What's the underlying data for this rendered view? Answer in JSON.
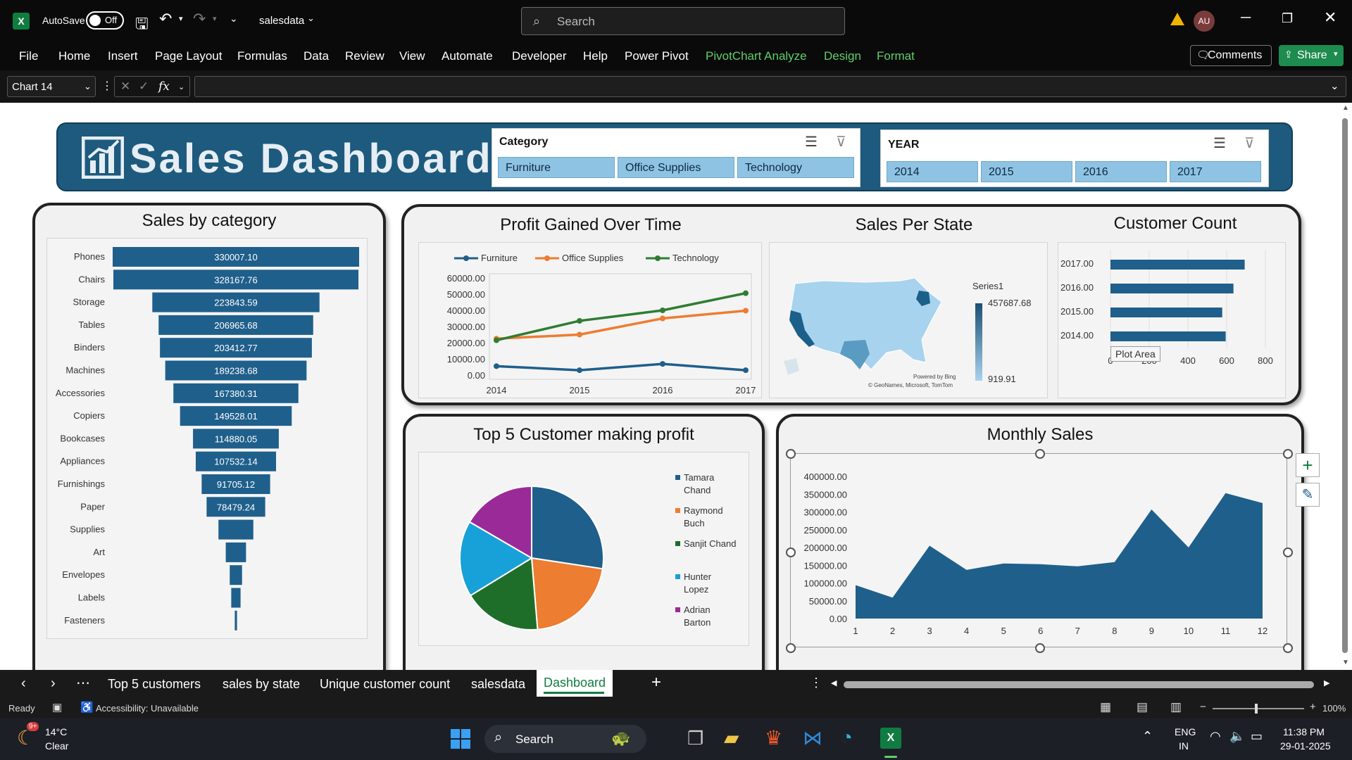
{
  "app": {
    "autosave_label": "AutoSave",
    "autosave_state": "Off",
    "filename": "salesdata",
    "search_placeholder": "Search",
    "user_initials": "AU"
  },
  "ribbon": {
    "tabs": [
      "File",
      "Home",
      "Insert",
      "Page Layout",
      "Formulas",
      "Data",
      "Review",
      "View",
      "Automate",
      "Developer",
      "Help",
      "Power Pivot",
      "PivotChart Analyze",
      "Design",
      "Format"
    ],
    "comments_label": "Comments",
    "share_label": "Share"
  },
  "formula_bar": {
    "name_box": "Chart 14",
    "fx": "fx",
    "value": ""
  },
  "dashboard": {
    "title": "Sales Dashboard",
    "slicer_category": {
      "title": "Category",
      "items": [
        "Furniture",
        "Office Supplies",
        "Technology"
      ]
    },
    "slicer_year": {
      "title": "YEAR",
      "items": [
        "2014",
        "2015",
        "2016",
        "2017"
      ]
    }
  },
  "charts": {
    "sales_by_category_title": "Sales by category",
    "profit_title": "Profit Gained Over Time",
    "state_title": "Sales Per State",
    "customer_title": "Customer Count",
    "top5_title": "Top 5 Customer making profit",
    "monthly_title": "Monthly Sales",
    "map_legend_series": "Series1",
    "map_legend_max": "457687.68",
    "map_legend_min": "919.91",
    "map_credit_1": "Powered by Bing",
    "map_credit_2": "© GeoNames, Microsoft, TomTom",
    "plot_area_tooltip": "Plot Area"
  },
  "chart_data": [
    {
      "type": "bar",
      "title": "Sales by category",
      "categories": [
        "Phones",
        "Chairs",
        "Storage",
        "Tables",
        "Binders",
        "Machines",
        "Accessories",
        "Copiers",
        "Bookcases",
        "Appliances",
        "Furnishings",
        "Paper",
        "Supplies",
        "Art",
        "Envelopes",
        "Labels",
        "Fasteners"
      ],
      "values": [
        330007.1,
        328167.76,
        223843.59,
        206965.68,
        203412.77,
        189238.68,
        167380.31,
        149528.01,
        114880.05,
        107532.14,
        91705.12,
        78479.24,
        46673.54,
        27118.79,
        16476.4,
        12486.31,
        3024.28
      ],
      "labels": [
        "330007.10",
        "328167.76",
        "223843.59",
        "206965.68",
        "203412.77",
        "189238.68",
        "167380.31",
        "149528.01",
        "114880.05",
        "107532.14",
        "91705.12",
        "78479.24",
        "",
        "",
        "",
        "",
        ""
      ]
    },
    {
      "type": "line",
      "title": "Profit Gained Over Time",
      "categories": [
        "2014",
        "2015",
        "2016",
        "2017"
      ],
      "ylim": [
        0,
        60000
      ],
      "yticks": [
        "0.00",
        "10000.00",
        "20000.00",
        "30000.00",
        "40000.00",
        "50000.00",
        "60000.00"
      ],
      "series": [
        {
          "name": "Furniture",
          "color": "#1f5f8b",
          "values": [
            5500,
            3000,
            6900,
            3000
          ]
        },
        {
          "name": "Office Supplies",
          "color": "#ed7d31",
          "values": [
            22500,
            25000,
            35000,
            39800
          ]
        },
        {
          "name": "Technology",
          "color": "#2e7d32",
          "values": [
            21500,
            33500,
            40000,
            50600
          ]
        }
      ]
    },
    {
      "type": "bar",
      "title": "Customer Count",
      "categories": [
        "2017.00",
        "2016.00",
        "2015.00",
        "2014.00"
      ],
      "values": [
        693,
        635,
        577,
        595
      ],
      "xlim": [
        0,
        800
      ],
      "xticks": [
        "0",
        "200",
        "400",
        "600",
        "800"
      ]
    },
    {
      "type": "pie",
      "title": "Top 5 Customer making profit",
      "series": [
        {
          "name": "Tamara Chand",
          "color": "#1f5f8b",
          "value": 8981
        },
        {
          "name": "Raymond Buch",
          "color": "#ed7d31",
          "value": 6976
        },
        {
          "name": "Sanjit Chand",
          "color": "#1e6e2a",
          "value": 5757
        },
        {
          "name": "Hunter Lopez",
          "color": "#18a0d8",
          "value": 5622
        },
        {
          "name": "Adrian Barton",
          "color": "#9b2a99",
          "value": 5444
        }
      ]
    },
    {
      "type": "area",
      "title": "Monthly Sales",
      "categories": [
        "1",
        "2",
        "3",
        "4",
        "5",
        "6",
        "7",
        "8",
        "9",
        "10",
        "11",
        "12"
      ],
      "values": [
        94000,
        59000,
        205000,
        137000,
        155000,
        153000,
        147000,
        159000,
        307000,
        200000,
        353000,
        325000
      ],
      "ylim": [
        0,
        400000
      ],
      "yticks": [
        "0.00",
        "50000.00",
        "100000.00",
        "150000.00",
        "200000.00",
        "250000.00",
        "300000.00",
        "350000.00",
        "400000.00"
      ]
    }
  ],
  "sheet_tabs": [
    "Top 5 customers",
    "sales by state",
    "Unique customer count",
    "salesdata",
    "Dashboard"
  ],
  "status": {
    "ready": "Ready",
    "accessibility": "Accessibility: Unavailable",
    "zoom": "100%"
  },
  "taskbar": {
    "temp": "14°C",
    "weather": "Clear",
    "weather_badge": "9+",
    "search": "Search",
    "lang1": "ENG",
    "lang2": "IN",
    "time": "11:38 PM",
    "date": "29-01-2025"
  },
  "colors": {
    "accent_dark": "#1f5f8b",
    "header_band": "#1d5a7e",
    "excel_green": "#107c41"
  }
}
